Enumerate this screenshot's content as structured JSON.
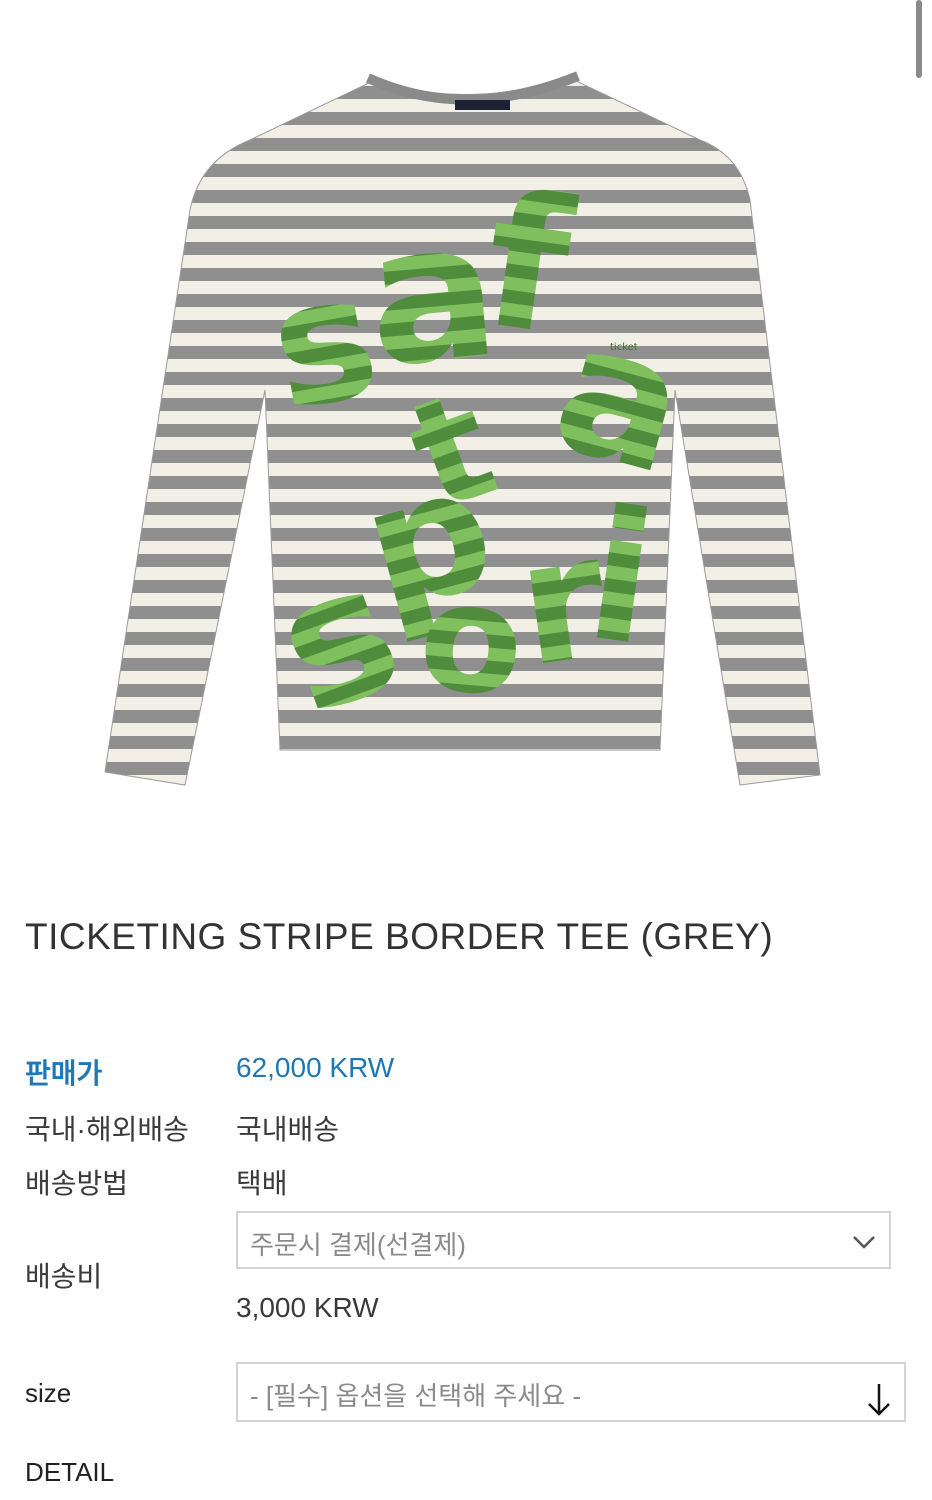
{
  "product": {
    "title": "TICKETING STRIPE BORDER TEE (GREY)",
    "image_alt": "striped long sleeve tee with green safari sport print",
    "print_text": "safari sport"
  },
  "info": {
    "price_label": "판매가",
    "price_value": "62,000 KRW",
    "shipping_region_label": "국내·해외배송",
    "shipping_region_value": "국내배송",
    "shipping_method_label": "배송방법",
    "shipping_method_value": "택배",
    "shipping_fee_label": "배송비",
    "shipping_fee_option": "주문시 결제(선결제)",
    "shipping_fee_value": "3,000 KRW"
  },
  "options": {
    "size_label": "size",
    "size_placeholder": "- [필수] 옵션을 선택해 주세요 -"
  },
  "detail_label": "DETAIL",
  "colors": {
    "accent": "#1e78b4",
    "stripe_grey": "#8f8f8f",
    "stripe_cream": "#f1efe6",
    "print_green": "#6aa84f"
  },
  "icons": {
    "dropdown": "chevron-down-icon",
    "size_dropdown": "arrow-down-icon"
  }
}
